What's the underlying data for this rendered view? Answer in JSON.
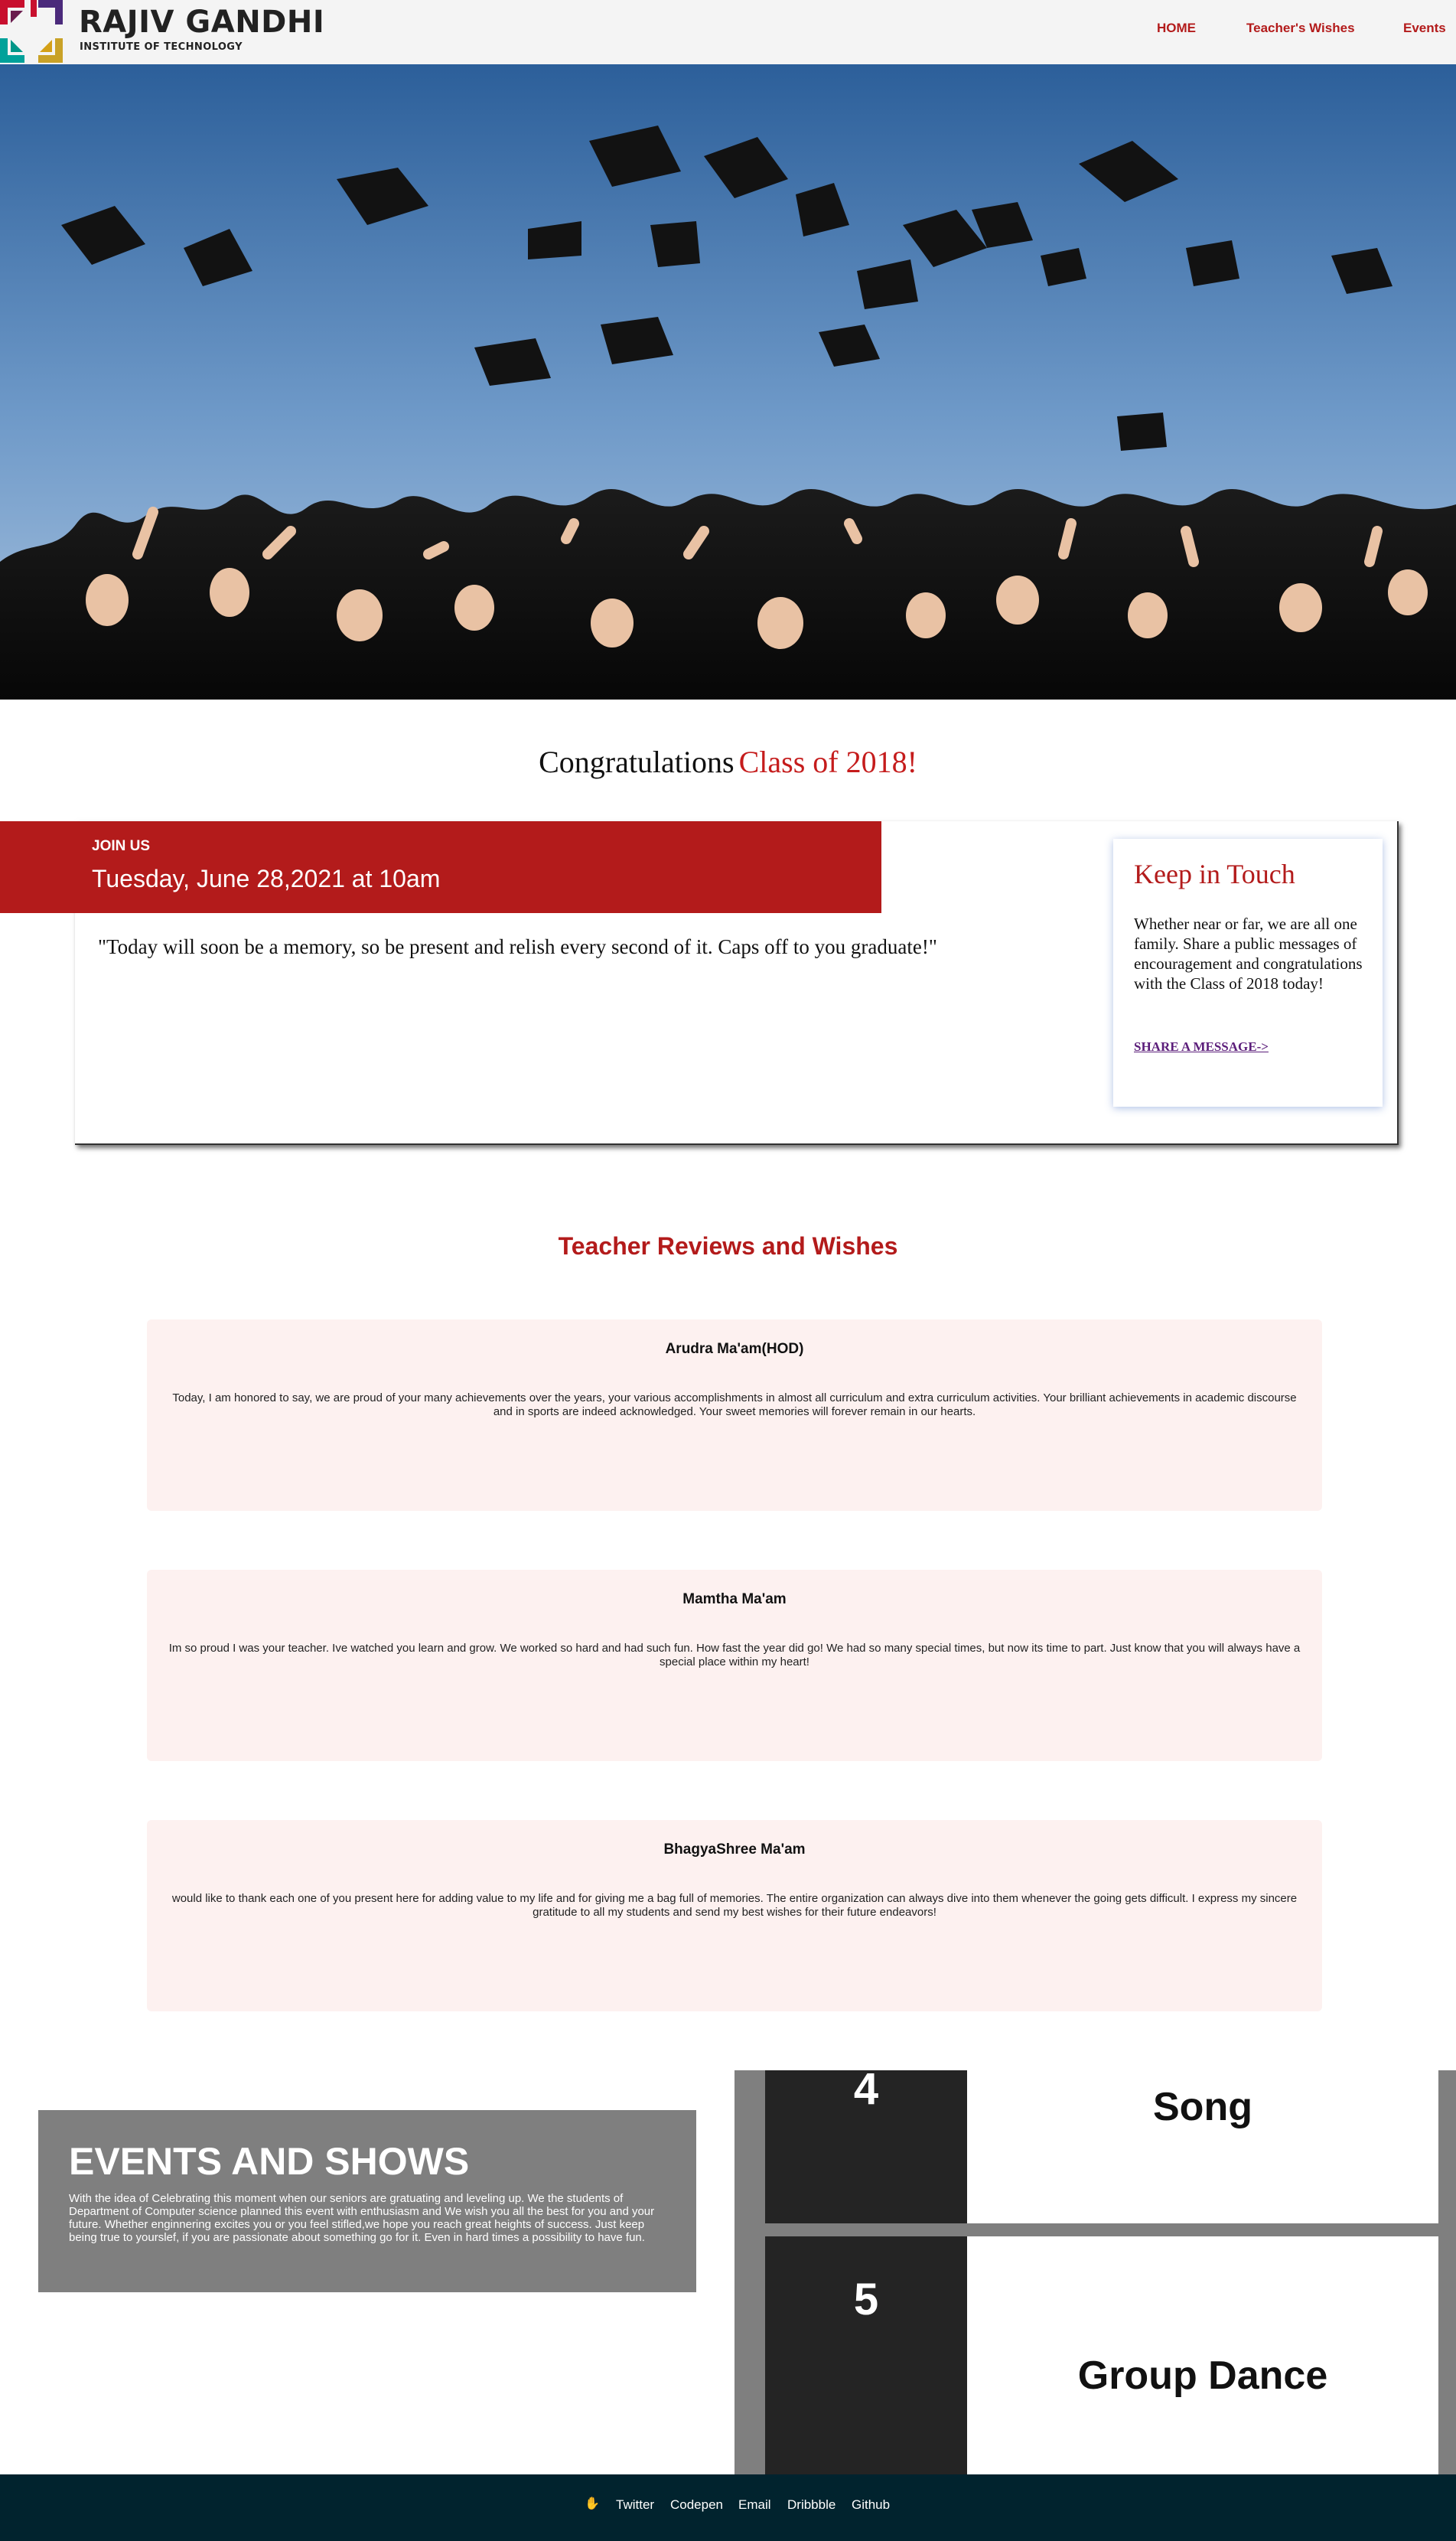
{
  "header": {
    "logo_title": "RAJIV GANDHI",
    "logo_subtitle": "INSTITUTE OF TECHNOLOGY",
    "nav": [
      "HOME",
      "Teacher's Wishes",
      "Events"
    ],
    "accent_color": "#b31b1b"
  },
  "hero": {
    "image": "graduates throwing caps into blue sky"
  },
  "congrats": {
    "lead": "Congratulations",
    "accent": "Class of 2018!"
  },
  "join": {
    "label": "JOIN US",
    "date": "Tuesday, June 28,2021 at 10am",
    "quote": "\"Today will soon be a memory, so be present and relish every second of it. Caps off to you graduate!\""
  },
  "keep_in_touch": {
    "title": "Keep in Touch",
    "text": "Whether near or far, we are all one family. Share a public messages of encouragement and congratulations with the Class of 2018 today!",
    "link": "SHARE A MESSAGE->"
  },
  "reviews": {
    "title": "Teacher Reviews and Wishes",
    "items": [
      {
        "name": "Arudra Ma'am(HOD)",
        "text": "Today, I am honored to say, we are proud of your many achievements over the years, your various accomplishments in almost all curriculum and extra curriculum activities. Your brilliant achievements in academic discourse and in sports are indeed acknowledged. Your sweet memories will forever remain in our hearts."
      },
      {
        "name": "Mamtha Ma'am",
        "text": "Im so proud I was your teacher. Ive watched you learn and grow. We worked so hard and had such fun. How fast the year did go! We had so many special times, but now its time to part. Just know that you will always have a special place within my heart!"
      },
      {
        "name": "BhagyaShree Ma'am",
        "text": "would like to thank each one of you present here for adding value to my life and for giving me a bag full of memories. The entire organization can always dive into them whenever the going gets difficult. I express my sincere gratitude to all my students and send my best wishes for their future endeavors!"
      }
    ]
  },
  "events": {
    "title": "EVENTS AND SHOWS",
    "text": "With the idea of Celebrating this moment when our seniors are gratuating and leveling up. We the students of Department of Computer science planned this event with enthusiasm and We wish you all the best for you and your future. Whether enginnering excites you or you feel stifled,we hope you reach great heights of success. Just keep being true to yourslef, if you are passionate about something go for it. Even in hard times a possibility to have fun.",
    "items": [
      {
        "number": "4",
        "name": "Song"
      },
      {
        "number": "5",
        "name": "Group Dance"
      }
    ]
  },
  "footer": {
    "icon": "waving-hand-icon",
    "links": [
      "Twitter",
      "Codepen",
      "Email",
      "Dribbble",
      "Github"
    ]
  }
}
